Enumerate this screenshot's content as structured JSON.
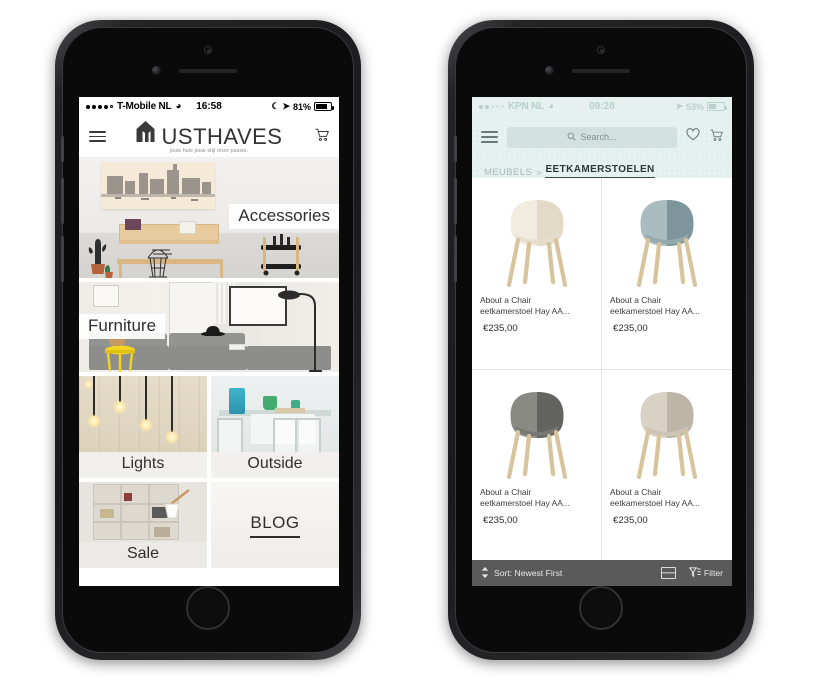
{
  "left_phone": {
    "status_bar": {
      "carrier": "T-Mobile NL",
      "time": "16:58",
      "battery": "81%",
      "wifi_icon": "wifi-icon",
      "moon_icon": "moon-icon",
      "location_icon": "location-arrow-icon"
    },
    "header": {
      "menu_icon": "hamburger-menu-icon",
      "logo_text": "USTHAVES",
      "logo_mark": "house-m-logo-icon",
      "tagline": "jouw huis jouw stijl onze passie.",
      "cart_icon": "shopping-cart-icon"
    },
    "tiles": [
      {
        "label": "Accessories",
        "name": "tile-accessories"
      },
      {
        "label": "Furniture",
        "name": "tile-furniture"
      },
      {
        "label": "Lights",
        "name": "tile-lights"
      },
      {
        "label": "Outside",
        "name": "tile-outside"
      },
      {
        "label": "Sale",
        "name": "tile-sale"
      },
      {
        "label": "BLOG",
        "name": "tile-blog"
      }
    ]
  },
  "right_phone": {
    "status_bar": {
      "carrier": "KPN NL",
      "time": "09:28",
      "battery": "53%"
    },
    "header": {
      "menu_icon": "hamburger-menu-icon",
      "search_placeholder": "Search...",
      "search_icon": "search-icon",
      "wishlist_icon": "heart-icon",
      "cart_icon": "shopping-cart-icon"
    },
    "breadcrumb": {
      "parent": "MEUBELS",
      "separator": ">",
      "current": "EETKAMERSTOELEN"
    },
    "products": [
      {
        "title": "About a Chair\neetkamerstoel Hay AA...",
        "price": "€235,00",
        "color": "#f2ece0",
        "shade": "#e2d9c7"
      },
      {
        "title": "About a Chair\neetkamerstoel Hay AA...",
        "price": "€235,00",
        "color": "#a9bcc0",
        "shade": "#7e969b"
      },
      {
        "title": "About a Chair\neetkamerstoel Hay AA...",
        "price": "€235,00",
        "color": "#8a8a85",
        "shade": "#636360"
      },
      {
        "title": "About a Chair\neetkamerstoel Hay AA...",
        "price": "€235,00",
        "color": "#d8d2c4",
        "shade": "#bdb6a6"
      }
    ],
    "bottom_bar": {
      "sort_label": "Sort: Newest First",
      "sort_icon": "sort-updown-icon",
      "view_toggle_icon": "grid-view-toggle-icon",
      "filter_label": "Filter",
      "filter_icon": "funnel-filter-icon"
    }
  },
  "colors": {
    "header_tint": "#e3f0ef",
    "bottom_bar": "#5a5a5a",
    "frame": "#1a1a1c"
  }
}
